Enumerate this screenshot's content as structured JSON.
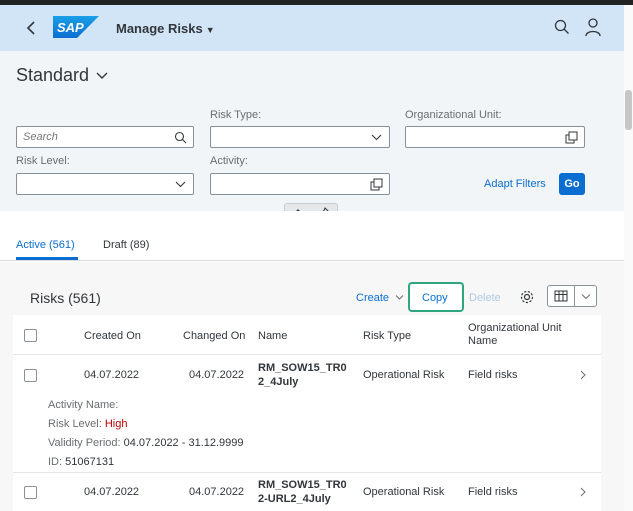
{
  "shell": {
    "app_title": "Manage Risks",
    "logo_text": "SAP",
    "colors": {
      "shell_bg": "#d1e5f7",
      "accent": "#0a6ed1",
      "copy_highlight": "#2ea57f",
      "high_risk": "#bb0000"
    }
  },
  "header": {
    "variant": "Standard",
    "filters": {
      "search_placeholder": "Search",
      "risk_type_label": "Risk Type:",
      "org_unit_label": "Organizational Unit:",
      "risk_level_label": "Risk Level:",
      "activity_label": "Activity:"
    },
    "adapt_filters": "Adapt Filters",
    "go": "Go"
  },
  "tabs": [
    {
      "label": "Active (561)"
    },
    {
      "label": "Draft (89)"
    }
  ],
  "table": {
    "title": "Risks (561)",
    "toolbar": {
      "create": "Create",
      "copy": "Copy",
      "delete": "Delete"
    },
    "columns": [
      "Created On",
      "Changed On",
      "Name",
      "Risk Type",
      "Organizational Unit Name"
    ],
    "rows": [
      {
        "created": "04.07.2022",
        "changed": "04.07.2022",
        "name_line1": "RM_SOW15_TR0",
        "name_line2": "2_4July",
        "risk_type": "Operational Risk",
        "org_unit": "Field risks",
        "details": {
          "activity_label": "Activity Name:",
          "activity_value": "",
          "risk_level_label": "Risk Level:",
          "risk_level_value": "High",
          "validity_label": "Validity Period:",
          "validity_value": "04.07.2022 - 31.12.9999",
          "id_label": "ID:",
          "id_value": "51067131"
        }
      },
      {
        "created": "04.07.2022",
        "changed": "04.07.2022",
        "name_line1": "RM_SOW15_TR0",
        "name_line2": "2-URL2_4July",
        "risk_type": "Operational Risk",
        "org_unit": "Field risks"
      }
    ]
  }
}
